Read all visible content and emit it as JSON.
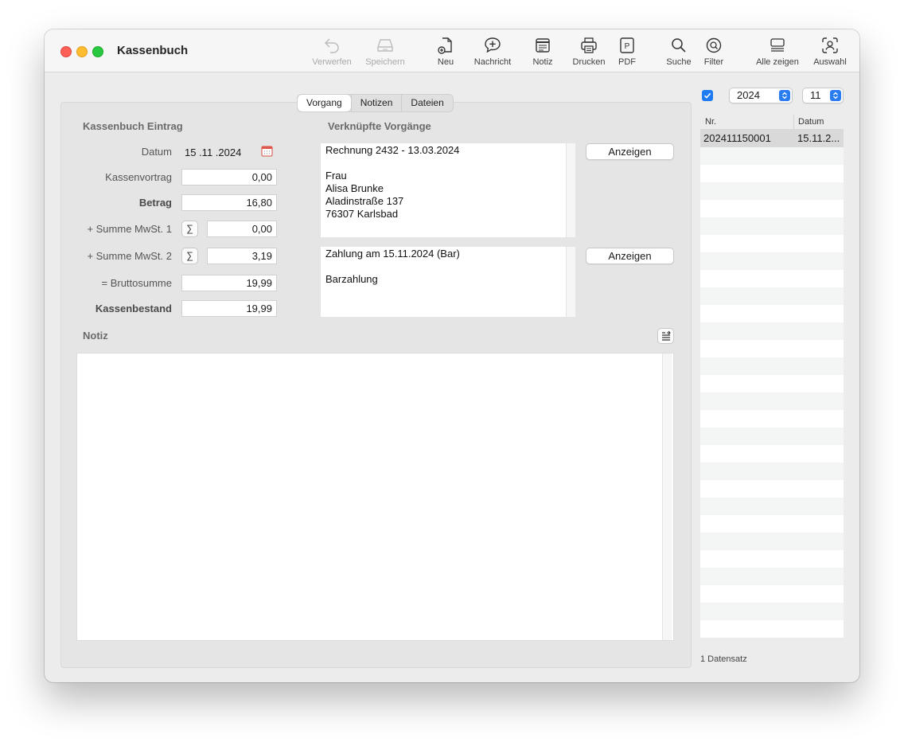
{
  "window": {
    "title": "Kassenbuch"
  },
  "toolbar": {
    "verwerfen": "Verwerfen",
    "speichern": "Speichern",
    "neu": "Neu",
    "nachricht": "Nachricht",
    "notiz": "Notiz",
    "drucken": "Drucken",
    "pdf": "PDF",
    "suche": "Suche",
    "filter": "Filter",
    "alle_zeigen": "Alle zeigen",
    "auswahl": "Auswahl"
  },
  "tabs": [
    "Vorgang",
    "Notizen",
    "Dateien"
  ],
  "entry": {
    "heading": "Kassenbuch Eintrag",
    "datum_label": "Datum",
    "datum_value": "15 .11 .2024",
    "kassenvortrag_label": "Kassenvortrag",
    "kassenvortrag_value": "0,00",
    "betrag_label": "Betrag",
    "betrag_value": "16,80",
    "mwst1_label": "+ Summe MwSt. 1",
    "mwst1_value": "0,00",
    "mwst2_label": "+ Summe MwSt. 2",
    "mwst2_value": "3,19",
    "brutto_label": "= Bruttosumme",
    "brutto_value": "19,99",
    "bestand_label": "Kassenbestand",
    "bestand_value": "19,99",
    "sigma": "∑"
  },
  "linked": {
    "heading": "Verknüpfte Vorgänge",
    "box1": "Rechnung 2432 - 13.03.2024\n\nFrau\nAlisa Brunke\nAladinstraße 137\n76307 Karlsbad",
    "box2": "Zahlung am 15.11.2024 (Bar)\n\nBarzahlung",
    "anzeigen1": "Anzeigen",
    "anzeigen2": "Anzeigen"
  },
  "notiz": {
    "heading": "Notiz",
    "text": ""
  },
  "sidebar": {
    "year": "2024",
    "month": "11",
    "columns": [
      "Nr.",
      "Datum"
    ],
    "rows": [
      {
        "nr": "202411150001",
        "datum": "15.11.2..."
      }
    ],
    "status": "1 Datensatz"
  },
  "colors": {
    "accent": "#1f7bf2",
    "selected_row": "#d9d9d9"
  }
}
